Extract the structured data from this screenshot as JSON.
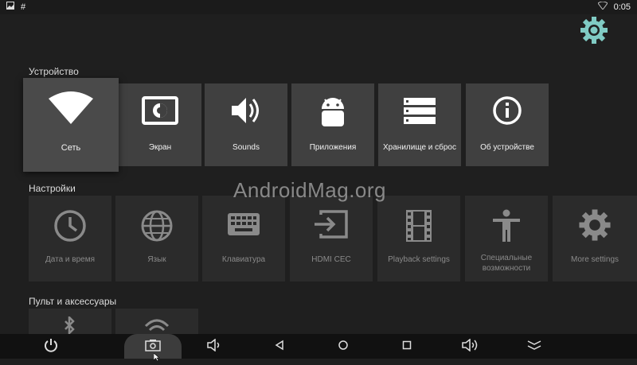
{
  "status": {
    "clock": "0:05"
  },
  "section1": {
    "title": "Устройство"
  },
  "section2": {
    "title": "Настройки"
  },
  "section3": {
    "title": "Пульт и аксессуары"
  },
  "device": [
    {
      "label": "Сеть",
      "icon": "wifi-icon"
    },
    {
      "label": "Экран",
      "icon": "display-icon"
    },
    {
      "label": "Sounds",
      "icon": "speaker-icon"
    },
    {
      "label": "Приложения",
      "icon": "android-icon"
    },
    {
      "label": "Хранилище и сброс",
      "icon": "storage-icon"
    },
    {
      "label": "Об устройстве",
      "icon": "info-icon"
    }
  ],
  "settings": [
    {
      "label": "Дата и время",
      "icon": "clock-icon"
    },
    {
      "label": "Язык",
      "icon": "globe-icon"
    },
    {
      "label": "Клавиатура",
      "icon": "keyboard-icon"
    },
    {
      "label": "HDMI CEC",
      "icon": "input-icon"
    },
    {
      "label": "Playback settings",
      "icon": "film-icon"
    },
    {
      "label": "Специальные возможности",
      "icon": "accessibility-icon"
    },
    {
      "label": "More settings",
      "icon": "gear-icon"
    }
  ],
  "remote": [
    {
      "icon": "bluetooth-icon"
    },
    {
      "icon": "remote-wifi-icon"
    }
  ],
  "watermark": "AndroidMag.org",
  "colors": {
    "accent": "#80cbc4"
  }
}
